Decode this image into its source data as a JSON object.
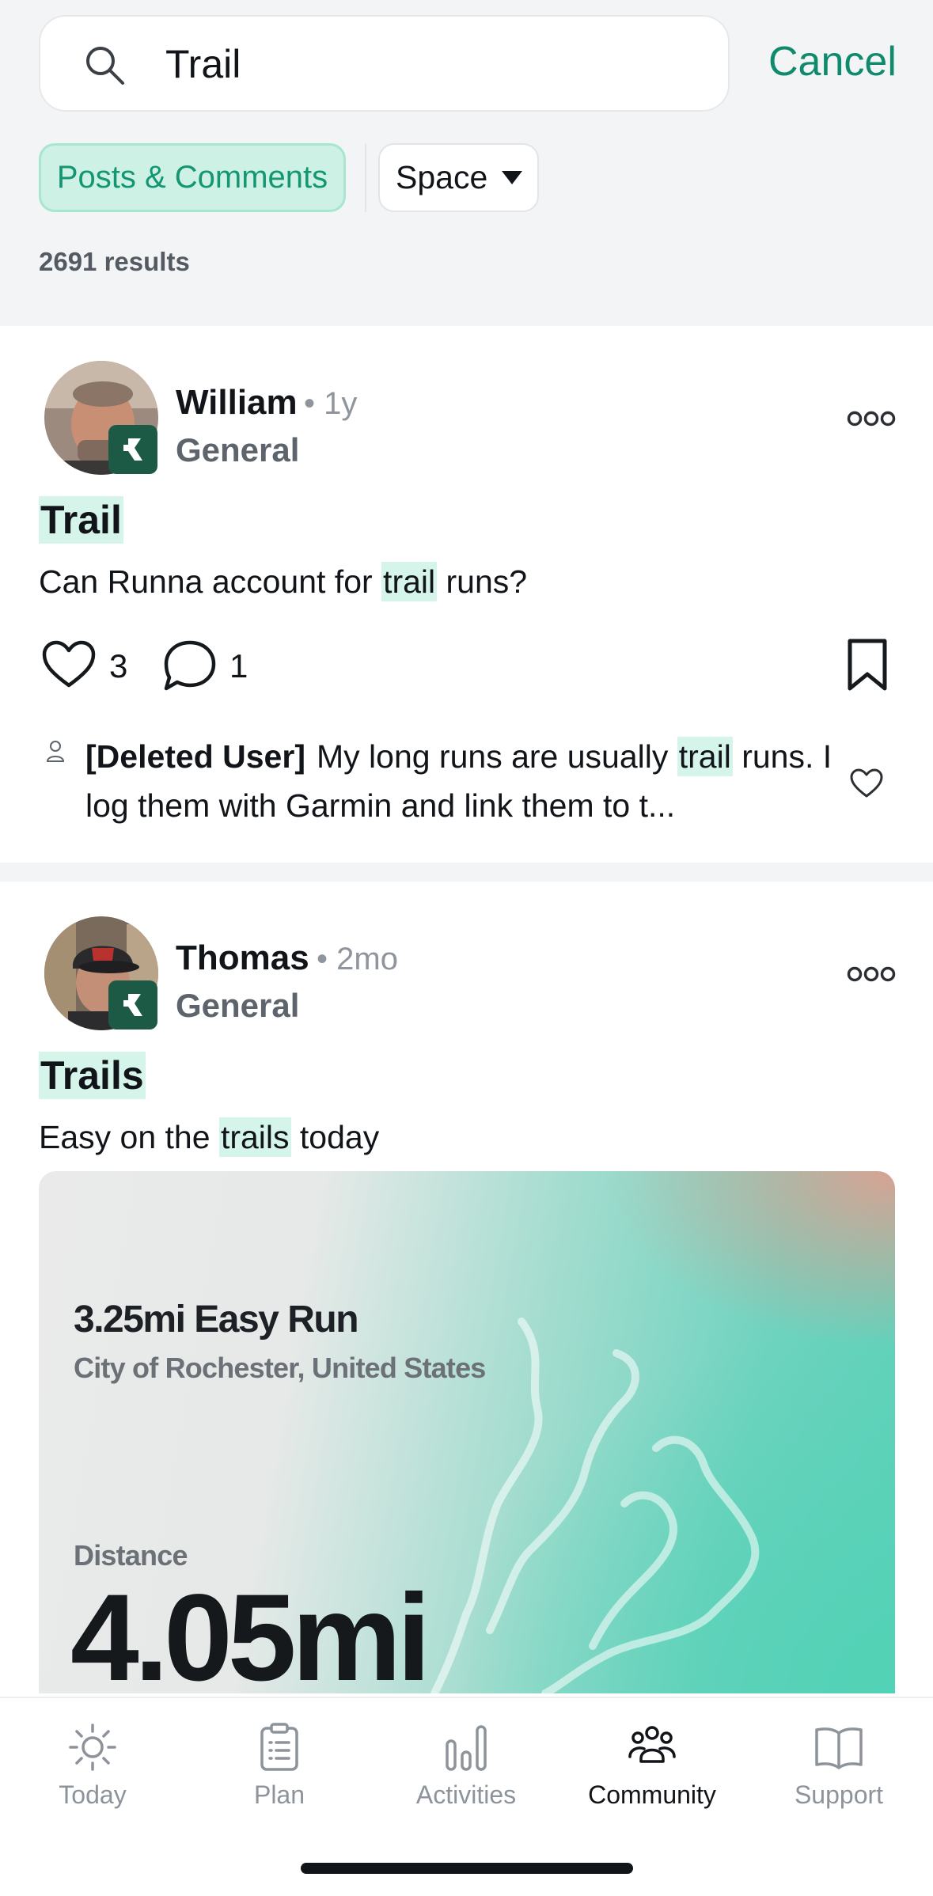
{
  "search": {
    "value": "Trail",
    "cancel_label": "Cancel"
  },
  "filters": {
    "posts_label": "Posts & Comments",
    "space_label": "Space"
  },
  "results_text": "2691 results",
  "posts": [
    {
      "author": "William",
      "time": "1y",
      "space": "General",
      "title": "Trail",
      "body_pre": "Can Runna account for ",
      "body_hl": "trail",
      "body_post": " runs?",
      "likes": "3",
      "comments": "1",
      "top_comment": {
        "author": "[Deleted User]",
        "text_pre": "My long runs are usually ",
        "text_hl": "trail",
        "text_post": " runs. I log them with Garmin and link them to t..."
      }
    },
    {
      "author": "Thomas",
      "time": "2mo",
      "space": "General",
      "title": "Trails",
      "body_pre": "Easy on the ",
      "body_hl": "trails",
      "body_post": " today",
      "activity": {
        "title": "3.25mi Easy Run",
        "location": "City of Rochester, United States",
        "distance_label": "Distance",
        "distance_value": "4.05mi"
      }
    }
  ],
  "tabs": [
    {
      "label": "Today",
      "icon": "sun-icon",
      "active": false
    },
    {
      "label": "Plan",
      "icon": "clipboard-icon",
      "active": false
    },
    {
      "label": "Activities",
      "icon": "bar-chart-icon",
      "active": false
    },
    {
      "label": "Community",
      "icon": "people-icon",
      "active": true
    },
    {
      "label": "Support",
      "icon": "book-icon",
      "active": false
    }
  ],
  "colors": {
    "accent": "#0f8a6c",
    "highlight": "#d6f5ea",
    "chip_bg": "#cdf1e4",
    "badge": "#1c5a46"
  }
}
